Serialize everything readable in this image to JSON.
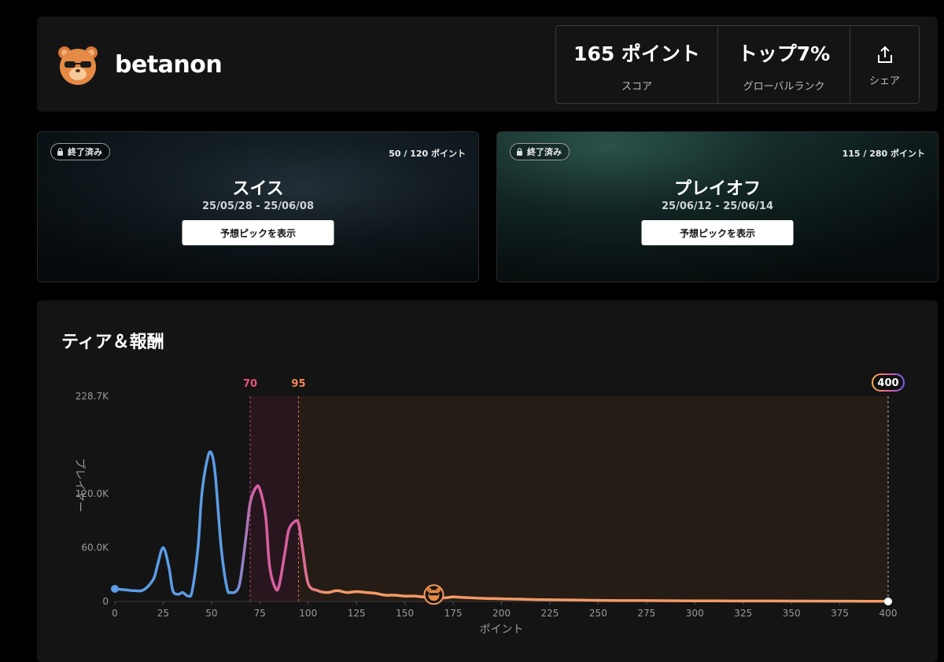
{
  "profile": {
    "username": "betanon",
    "avatar_icon": "bear-with-sunglasses-icon",
    "score_value": "165 ポイント",
    "score_label": "スコア",
    "rank_value": "トップ7%",
    "rank_label": "グローバルランク",
    "share_label": "シェア",
    "share_icon": "share-icon"
  },
  "stages": [
    {
      "status": "終了済み",
      "points": "50 / 120 ポイント",
      "title": "スイス",
      "dates": "25/05/28 - 25/06/08",
      "button": "予想ピックを表示"
    },
    {
      "status": "終了済み",
      "points": "115 / 280 ポイント",
      "title": "プレイオフ",
      "dates": "25/06/12 - 25/06/14",
      "button": "予想ピックを表示"
    }
  ],
  "tiers": {
    "title": "ティア＆報酬"
  },
  "chart_data": {
    "type": "line",
    "xlabel": "ポイント",
    "ylabel": "プレイヤー",
    "xlim": [
      0,
      400
    ],
    "ylim": [
      0,
      228700
    ],
    "x_ticks": [
      0,
      25,
      50,
      75,
      100,
      125,
      150,
      175,
      200,
      225,
      250,
      275,
      300,
      325,
      350,
      375,
      400
    ],
    "x_tick_labels": [
      "0",
      "25",
      "50",
      "75",
      "100",
      "125",
      "150",
      "175",
      "200",
      "225",
      "250",
      "275",
      "300",
      "325",
      "350",
      "375",
      "400"
    ],
    "y_ticks": [
      0,
      60000,
      120000,
      228700
    ],
    "y_tick_labels": [
      "0",
      "60.0K",
      "120.0K",
      "228.7K"
    ],
    "tier_thresholds": [
      {
        "label": "70",
        "value": 70,
        "color": "#e8537a"
      },
      {
        "label": "95",
        "value": 95,
        "color": "#f48a5a"
      },
      {
        "label": "400",
        "value": 400,
        "color": "#ffffff"
      }
    ],
    "user_marker": {
      "x": 165,
      "icon": "bear-avatar-icon"
    },
    "colors": {
      "low": "#5b9ce6",
      "mid": "#d85fa0",
      "high": "#f39a66"
    },
    "x": [
      0,
      5,
      10,
      15,
      20,
      22,
      25,
      28,
      30,
      33,
      35,
      38,
      40,
      43,
      45,
      48,
      50,
      52,
      55,
      58,
      60,
      63,
      65,
      68,
      70,
      73,
      75,
      78,
      80,
      83,
      85,
      88,
      90,
      93,
      95,
      97,
      100,
      105,
      110,
      115,
      120,
      125,
      130,
      135,
      140,
      145,
      150,
      155,
      160,
      165,
      170,
      175,
      180,
      190,
      200,
      210,
      220,
      230,
      240,
      250,
      260,
      280,
      300,
      320,
      340,
      360,
      380,
      400
    ],
    "y": [
      14000,
      13000,
      12000,
      13000,
      25000,
      40000,
      60000,
      38000,
      12000,
      8000,
      10000,
      6000,
      12000,
      60000,
      120000,
      160000,
      165000,
      140000,
      60000,
      15000,
      10000,
      12000,
      25000,
      75000,
      110000,
      127000,
      125000,
      95000,
      40000,
      15000,
      18000,
      55000,
      80000,
      89000,
      87000,
      60000,
      20000,
      12000,
      10000,
      12000,
      10000,
      11000,
      10000,
      9000,
      7000,
      7000,
      6000,
      6000,
      5000,
      5000,
      4000,
      5000,
      4500,
      3500,
      3000,
      2500,
      2000,
      1800,
      1500,
      1200,
      1000,
      900,
      700,
      600,
      500,
      400,
      300,
      200
    ]
  }
}
